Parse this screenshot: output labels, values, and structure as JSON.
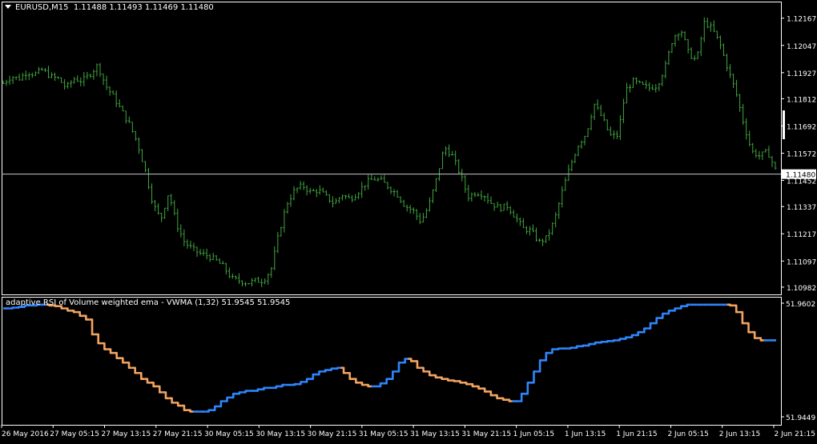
{
  "symbol_header": {
    "symbol": "EURUSD,M15",
    "quote": "1.11488 1.11493 1.11469 1.11480"
  },
  "indicator_header": {
    "text": "adaptive RSI of Volume weighted ema - VWMA (1,32) 51.9545 51.9545"
  },
  "colors": {
    "background": "#000000",
    "grid": "#ffffff",
    "bars": "#3fa63f",
    "indicator_up": "#2e86ff",
    "indicator_down": "#f4a460",
    "price_line": "#c8c8c8"
  },
  "chart_data": [
    {
      "type": "line",
      "title": "EURUSD,M15",
      "style": "ohlc-bars",
      "ylim": [
        1.1095,
        1.1224
      ],
      "yticks": [
        "1.12167",
        "1.12047",
        "1.11927",
        "1.11812",
        "1.11692",
        "1.11572",
        "1.11452",
        "1.11337",
        "1.11217",
        "1.11097",
        "1.10982"
      ],
      "current_price": "1.11480",
      "close_series": [
        1.1188,
        1.1191,
        1.119,
        1.1193,
        1.1192,
        1.1194,
        1.1191,
        1.119,
        1.1186,
        1.119,
        1.1189,
        1.1192,
        1.1196,
        1.1187,
        1.1182,
        1.1176,
        1.117,
        1.1162,
        1.115,
        1.1135,
        1.1128,
        1.114,
        1.1126,
        1.1118,
        1.1115,
        1.1113,
        1.1112,
        1.111,
        1.1107,
        1.1102,
        1.1101,
        1.11,
        1.1101,
        1.1101,
        1.1106,
        1.1122,
        1.1135,
        1.1141,
        1.1143,
        1.114,
        1.1141,
        1.1138,
        1.1135,
        1.1139,
        1.1137,
        1.114,
        1.1144,
        1.1146,
        1.1145,
        1.1142,
        1.1139,
        1.1134,
        1.1132,
        1.1127,
        1.1134,
        1.1146,
        1.116,
        1.1156,
        1.1148,
        1.1138,
        1.114,
        1.1139,
        1.1135,
        1.1133,
        1.1134,
        1.1129,
        1.1124,
        1.1123,
        1.1118,
        1.112,
        1.1128,
        1.1141,
        1.1152,
        1.1161,
        1.1166,
        1.1179,
        1.1173,
        1.1165,
        1.1165,
        1.1185,
        1.1189,
        1.1187,
        1.1186,
        1.1187,
        1.1195,
        1.1208,
        1.1212,
        1.1201,
        1.1198,
        1.1215,
        1.1212,
        1.1205,
        1.1194,
        1.1184,
        1.117,
        1.1158,
        1.1156,
        1.1158,
        1.115
      ]
    },
    {
      "type": "line",
      "title": "adaptive RSI of Volume weighted ema - VWMA (1,32) 51.9545 51.9545",
      "ylim": [
        51.9449,
        51.9602
      ],
      "yticks": [
        "51.9602",
        "51.9449"
      ],
      "series": [
        {
          "name": "VWMA",
          "values": [
            51.9595,
            51.9595,
            51.9596,
            51.9597,
            51.9599,
            51.9599,
            51.96,
            51.96,
            51.9599,
            51.9598,
            51.9595,
            51.9592,
            51.959,
            51.9585,
            51.958,
            51.956,
            51.9548,
            51.954,
            51.9535,
            51.9528,
            51.9522,
            51.9515,
            51.9508,
            51.95,
            51.9495,
            51.949,
            51.9482,
            51.9474,
            51.9468,
            51.9464,
            51.9458,
            51.9456,
            51.9456,
            51.9456,
            51.9458,
            51.9463,
            51.947,
            51.9475,
            51.948,
            51.9482,
            51.9484,
            51.9484,
            51.9486,
            51.9488,
            51.9488,
            51.949,
            51.9492,
            51.9492,
            51.9493,
            51.9496,
            51.95,
            51.9506,
            51.951,
            51.9512,
            51.9514,
            51.9515,
            51.9508,
            51.95,
            51.9495,
            51.9492,
            51.949,
            51.949,
            51.9494,
            51.95,
            51.951,
            51.9522,
            51.9527,
            51.9524,
            51.9515,
            51.951,
            51.9505,
            51.9502,
            51.95,
            51.9498,
            51.9497,
            51.9495,
            51.9493,
            51.949,
            51.9487,
            51.9483,
            51.9478,
            51.9474,
            51.9472,
            51.947,
            51.947,
            51.948,
            51.9495,
            51.951,
            51.9525,
            51.9535,
            51.954,
            51.9541,
            51.9541,
            51.9542,
            51.9544,
            51.9545,
            51.9547,
            51.9549,
            51.955,
            51.9551,
            51.9552,
            51.9554,
            51.9556,
            51.9559,
            51.9563,
            51.9568,
            51.9575,
            51.9582,
            51.9588,
            51.9592,
            51.9595,
            51.9598,
            51.96,
            51.96,
            51.96,
            51.96,
            51.96,
            51.96,
            51.96,
            51.9599,
            51.959,
            51.9575,
            51.9563,
            51.9555,
            51.9552,
            51.9552,
            51.9552
          ]
        }
      ]
    }
  ],
  "x_axis_labels": [
    "26 May 2016",
    "27 May 05:15",
    "27 May 13:15",
    "27 May 21:15",
    "30 May 05:15",
    "30 May 13:15",
    "30 May 21:15",
    "31 May 05:15",
    "31 May 13:15",
    "31 May 21:15",
    "1 Jun 05:15",
    "1 Jun 13:15",
    "1 Jun 21:15",
    "2 Jun 05:15",
    "2 Jun 13:15",
    "2 Jun 21:15"
  ]
}
